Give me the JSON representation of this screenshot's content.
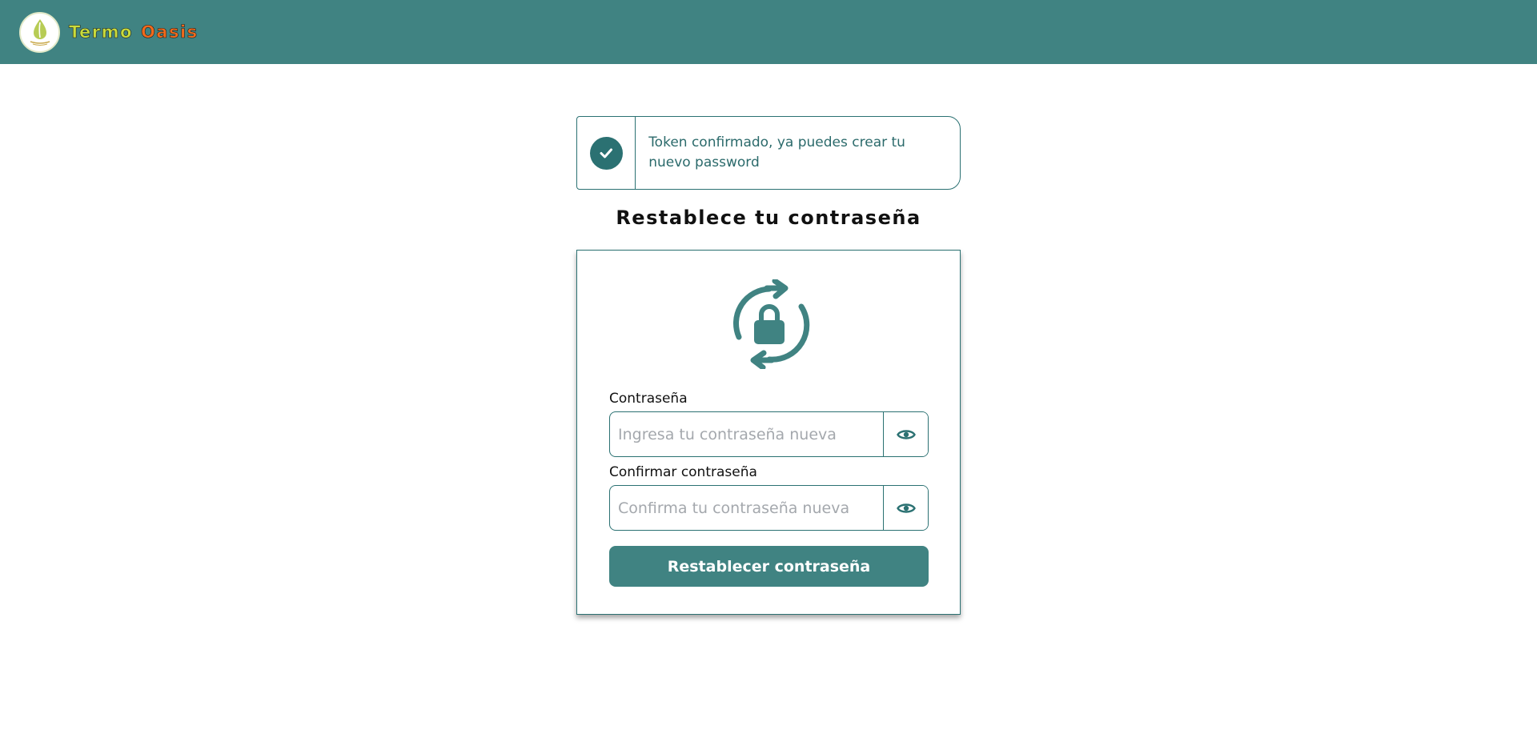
{
  "brand": {
    "name_part1": "Termo",
    "name_part2": "Oasis",
    "logo_icon": "leaf-drop-logo"
  },
  "alert": {
    "icon": "check-circle-icon",
    "message": "Token confirmado, ya puedes crear tu nuevo password"
  },
  "page": {
    "title": "Restablece tu contraseña"
  },
  "form": {
    "header_icon": "lock-refresh-icon",
    "password": {
      "label": "Contraseña",
      "placeholder": "Ingresa tu contraseña nueva",
      "value": "",
      "toggle_icon": "eye-icon"
    },
    "confirm_password": {
      "label": "Confirmar contraseña",
      "placeholder": "Confirma tu contraseña nueva",
      "value": "",
      "toggle_icon": "eye-icon"
    },
    "submit_label": "Restablecer contraseña"
  },
  "colors": {
    "primary": "#408382",
    "primary_dark": "#2b7172",
    "brand_green": "#c9dc3c",
    "brand_orange": "#f06a1c"
  }
}
